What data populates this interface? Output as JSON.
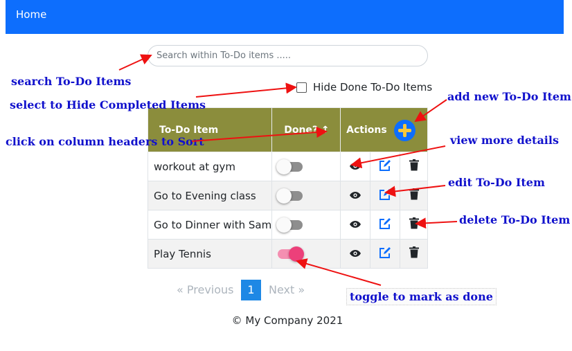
{
  "navbar": {
    "home_label": "Home"
  },
  "search": {
    "placeholder": "Search within To-Do items ....."
  },
  "filter": {
    "hide_done_label": "Hide Done To-Do Items",
    "checked": false
  },
  "table": {
    "headers": {
      "item": "To-Do Item",
      "done": "Done? ↑",
      "actions": "Actions"
    },
    "rows": [
      {
        "name": "workout at gym",
        "done": false
      },
      {
        "name": "Go to Evening class",
        "done": false
      },
      {
        "name": "Go to Dinner with Sam",
        "done": false
      },
      {
        "name": "Play Tennis",
        "done": true
      }
    ],
    "icons": {
      "view": "eye-icon",
      "edit": "edit-icon",
      "delete": "trash-icon",
      "add": "plus-circle-icon"
    }
  },
  "pagination": {
    "prev": "«  Previous",
    "current": "1",
    "next": "Next  »"
  },
  "footer": {
    "text": "© My Company 2021"
  },
  "annotations": {
    "search": "search To-Do Items",
    "hide": "select to Hide Completed Items",
    "sort": "click on column headers to Sort",
    "add": "add new To-Do Item",
    "view": "view more details",
    "edit": "edit To-Do Item",
    "delete": "delete To-Do Item",
    "toggle": "toggle to mark as done"
  },
  "colors": {
    "navbar": "#0d6efd",
    "table_header": "#8b8d3c",
    "annotation_text": "#1111cc",
    "annotation_arrow": "#ee1111",
    "toggle_on": "#ec407a",
    "pagination_active": "#1e88e5"
  }
}
